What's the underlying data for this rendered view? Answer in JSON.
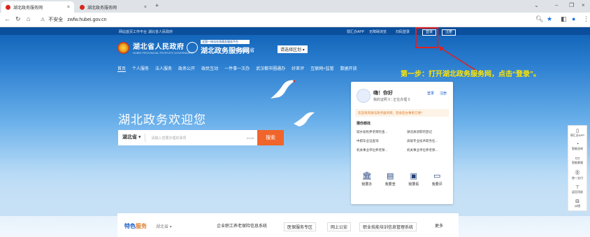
{
  "browser": {
    "tabs": [
      {
        "title": "湖北政务服务网"
      },
      {
        "title": "湖北政务服务网"
      }
    ],
    "security_label": "不安全",
    "url": "zwfw.hubei.gov.cn"
  },
  "topstrip": {
    "left_links": [
      "网站首页工作平台",
      "湖北省人民政府"
    ],
    "right_links": [
      "鄂汇办APP",
      "无障碍浏览",
      "扫码登录"
    ],
    "login": "登录",
    "register": "注册"
  },
  "header": {
    "gov_title": "湖北省人民政府",
    "gov_subtitle": "HUBEI PROVINCIAL PEOPLE'S GOVERNMENT",
    "platform_tag": "全国一体化在线政务服务平台",
    "platform_title": "湖北政务服务网",
    "location": "湖北省",
    "region_select": "请选择区划"
  },
  "menu": [
    "首页",
    "个人服务",
    "法人服务",
    "政务公开",
    "政民互动",
    "一件事一次办",
    "武汉都市圈通办",
    "好差评",
    "互联网+监管",
    "数据开放"
  ],
  "annotation": {
    "step_text": "第一步：打开湖北政务服务网，点击“登录”。"
  },
  "hero": {
    "welcome": "湖北政务欢迎您",
    "search_scope": "湖北省",
    "search_placeholder": "请输入您要办理的事项",
    "search_count": "0/128",
    "search_button": "搜索"
  },
  "user_card": {
    "greeting": "嗨！你好",
    "sub_left": "我的证照 0",
    "sub_right": "正在办理 0",
    "login": "登录",
    "register": "注册",
    "notice": "欢迎来到湖北政务服务网，登录后办事更方便！",
    "guess_title": "猜你想找",
    "guess_items": [
      "城乡居民养老保险查...",
      "湖北离退职的登记",
      "中职毕业证查询",
      "高级专业技术职务任...",
      "机关事业单位养老保...",
      "机关事业单位养老保..."
    ],
    "quick_links": [
      {
        "icon": "bank-icon",
        "label": "我要办"
      },
      {
        "icon": "document-search-icon",
        "label": "我要查"
      },
      {
        "icon": "monitor-icon",
        "label": "我要看"
      },
      {
        "icon": "comment-icon",
        "label": "我要评"
      }
    ]
  },
  "sidebar": [
    {
      "icon": "phone-icon",
      "label": "鄂汇办APP"
    },
    {
      "icon": "headset-icon",
      "label": "智能咨询"
    },
    {
      "icon": "chat-icon",
      "label": "智能客服"
    },
    {
      "icon": "number-icon",
      "label": "统一支付"
    },
    {
      "icon": "up-arrow-icon",
      "label": "返回顶部"
    },
    {
      "icon": "feedback-icon",
      "label": "纠错"
    }
  ],
  "bottom": {
    "title_a": "特色",
    "title_b": "服务",
    "region": "湖北省",
    "links": [
      "企业职工养老保险信息系统",
      "医保服务专区",
      "网上公安",
      "职业技能培训信息管理系统",
      "更多"
    ]
  },
  "colors": {
    "accent_orange": "#f0652b",
    "annotation_yellow": "#ffe600",
    "highlight_red": "#e02020",
    "brand_blue": "#0b4e9c"
  }
}
